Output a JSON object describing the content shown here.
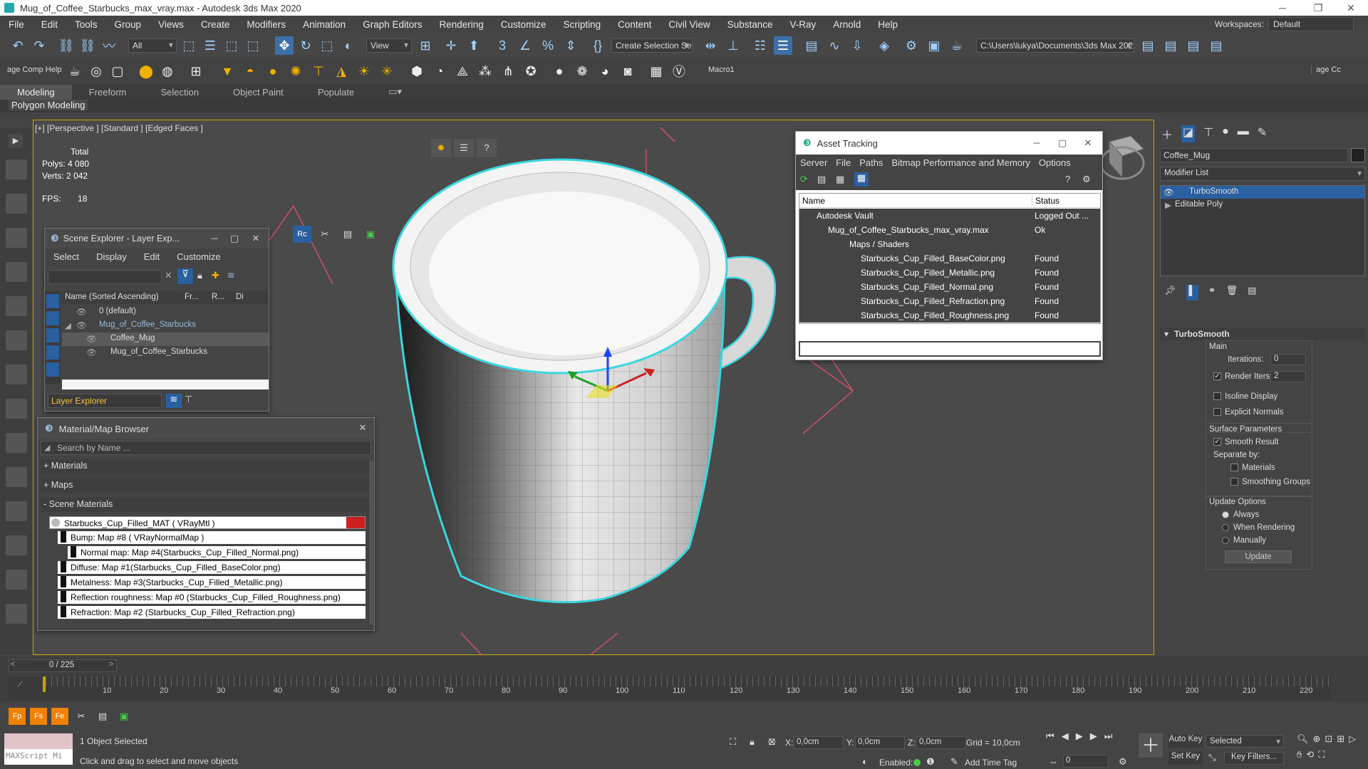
{
  "window": {
    "title": "Mug_of_Coffee_Starbucks_max_vray.max - Autodesk 3ds Max 2020"
  },
  "menu": [
    "File",
    "Edit",
    "Tools",
    "Group",
    "Views",
    "Create",
    "Modifiers",
    "Animation",
    "Graph Editors",
    "Rendering",
    "Customize",
    "Scripting",
    "Content",
    "Civil View",
    "Substance",
    "V-Ray",
    "Arnold",
    "Help"
  ],
  "workspaces": {
    "label": "Workspaces:",
    "value": "Default"
  },
  "toolbar": {
    "filter": "All",
    "view": "View",
    "selection_set": "Create Selection Se",
    "path": "C:\\Users\\lukya\\Documents\\3ds Max 2022",
    "macro": "Macro1",
    "comp_label": "age Comp Help",
    "comp_label_right": "age Cc"
  },
  "ribbon": {
    "tabs": [
      "Modeling",
      "Freeform",
      "Selection",
      "Object Paint",
      "Populate"
    ],
    "active": "Modeling",
    "sub": "Polygon Modeling"
  },
  "viewport": {
    "label": "[+] [Perspective ] [Standard ] [Edged Faces ]",
    "stats": {
      "total": "Total",
      "polys_label": "Polys:",
      "polys": "4 080",
      "verts_label": "Verts:",
      "verts": "2 042",
      "fps_label": "FPS:",
      "fps": "18"
    }
  },
  "scene_explorer": {
    "title": "Scene Explorer - Layer Exp...",
    "menu": [
      "Select",
      "Display",
      "Edit",
      "Customize"
    ],
    "columns": [
      "Name (Sorted Ascending)",
      "Fr...",
      "R...",
      "Di"
    ],
    "rows": [
      "0 (default)",
      "Mug_of_Coffee_Starbucks",
      "Coffee_Mug",
      "Mug_of_Coffee_Starbucks"
    ],
    "footer": "Layer Explorer"
  },
  "material_browser": {
    "title": "Material/Map Browser",
    "search_placeholder": "Search by Name ...",
    "groups": [
      "+ Materials",
      "+ Maps",
      "- Scene Materials"
    ],
    "material": "Starbucks_Cup_Filled_MAT  ( VRayMtl )",
    "maps": [
      "Bump: Map #8  ( VRayNormalMap )",
      "Normal map: Map #4(Starbucks_Cup_Filled_Normal.png)",
      "Diffuse: Map #1(Starbucks_Cup_Filled_BaseColor.png)",
      "Metalness: Map #3(Starbucks_Cup_Filled_Metallic.png)",
      "Reflection roughness: Map #0 (Starbucks_Cup_Filled_Roughness.png)",
      "Refraction: Map #2 (Starbucks_Cup_Filled_Refraction.png)"
    ]
  },
  "asset_tracking": {
    "title": "Asset Tracking",
    "menu": [
      "Server",
      "File",
      "Paths",
      "Bitmap Performance and Memory",
      "Options"
    ],
    "columns": [
      "Name",
      "Status"
    ],
    "rows": [
      {
        "name": "Autodesk Vault",
        "status": "Logged Out ..."
      },
      {
        "name": "Mug_of_Coffee_Starbucks_max_vray.max",
        "status": "Ok"
      },
      {
        "name": "Maps / Shaders",
        "status": ""
      },
      {
        "name": "Starbucks_Cup_Filled_BaseColor.png",
        "status": "Found"
      },
      {
        "name": "Starbucks_Cup_Filled_Metallic.png",
        "status": "Found"
      },
      {
        "name": "Starbucks_Cup_Filled_Normal.png",
        "status": "Found"
      },
      {
        "name": "Starbucks_Cup_Filled_Refraction.png",
        "status": "Found"
      },
      {
        "name": "Starbucks_Cup_Filled_Roughness.png",
        "status": "Found"
      }
    ]
  },
  "command_panel": {
    "object_name": "Coffee_Mug",
    "modifier_list": "Modifier List",
    "stack": [
      "TurboSmooth",
      "Editable Poly"
    ],
    "rollout": "TurboSmooth",
    "main": "Main",
    "iterations_label": "Iterations:",
    "iterations": "0",
    "render_iters_label": "Render Iters:",
    "render_iters": "2",
    "isoline": "Isoline Display",
    "explicit": "Explicit Normals",
    "surface": "Surface Parameters",
    "smooth_result": "Smooth Result",
    "separate": "Separate by:",
    "materials": "Materials",
    "smoothing_groups": "Smoothing Groups",
    "update_options": "Update Options",
    "always": "Always",
    "when_rendering": "When Rendering",
    "manually": "Manually",
    "update": "Update"
  },
  "timeline": {
    "frame": "0 / 225",
    "ticks": [
      "10",
      "20",
      "30",
      "40",
      "50",
      "60",
      "70",
      "80",
      "90",
      "100",
      "110",
      "120",
      "130",
      "140",
      "150",
      "160",
      "170",
      "180",
      "190",
      "200",
      "210",
      "220"
    ]
  },
  "status": {
    "maxscript": "MAXScript Mi",
    "selected": "1 Object Selected",
    "prompt": "Click and drag to select and move objects",
    "x_label": "X:",
    "x": "0,0cm",
    "y_label": "Y:",
    "y": "0,0cm",
    "z_label": "Z:",
    "z": "0,0cm",
    "grid": "Grid = 10,0cm",
    "enabled": "Enabled:",
    "add_time_tag": "Add Time Tag",
    "auto_key": "Auto Key",
    "set_key": "Set Key",
    "selected_dd": "Selected",
    "key_filters": "Key Filters...",
    "frame_field": "0"
  }
}
